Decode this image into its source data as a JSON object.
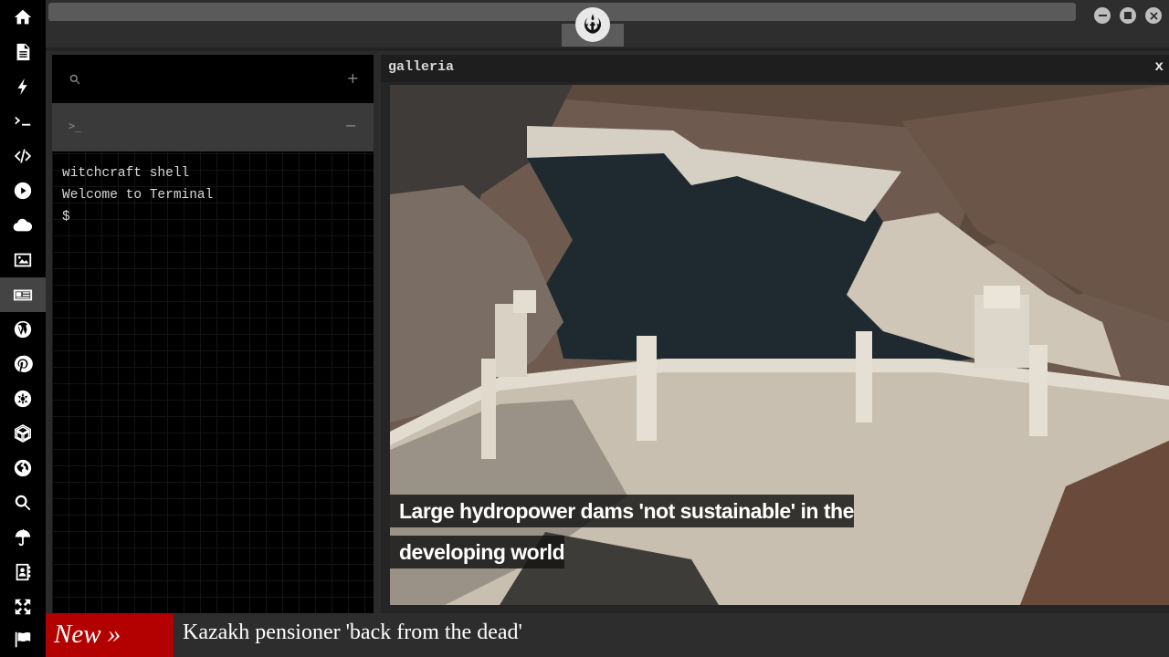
{
  "sidebar": {
    "icons": [
      "home-icon",
      "document-icon",
      "bolt-icon",
      "terminal-icon",
      "code-icon",
      "play-icon",
      "cloud-icon",
      "image-icon",
      "newspaper-icon",
      "wordpress-icon",
      "pinterest-icon",
      "settings-wheel-icon",
      "network-icon",
      "globe-icon",
      "search-icon",
      "umbrella-icon",
      "contacts-icon",
      "expand-icon",
      "flag-icon"
    ],
    "active": "newspaper-icon"
  },
  "terminal": {
    "tab_prompt": ">_",
    "plus": "+",
    "minus": "−",
    "lines": [
      "witchcraft shell",
      "Welcome to Terminal",
      "$"
    ]
  },
  "galleria": {
    "title": "galleria",
    "close": "x",
    "caption": "Large hydropower dams 'not sustainable' in the developing world"
  },
  "ticker": {
    "badge": "New »",
    "headline": "Kazakh pensioner 'back from the dead'"
  },
  "colors": {
    "ticker_badge": "#b30000",
    "sidebar_bg": "#000000"
  }
}
